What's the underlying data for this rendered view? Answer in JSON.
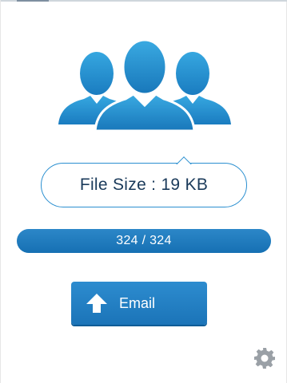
{
  "file_info": {
    "label": "File Size : 19 KB"
  },
  "progress": {
    "text": "324 / 324",
    "fraction": 1.0
  },
  "email_button": {
    "label": "Email",
    "icon": "up-arrow-icon"
  },
  "illustration": {
    "icon": "contacts-group-icon"
  },
  "settings": {
    "icon": "gear-icon"
  },
  "colors": {
    "accent": "#1b74b8",
    "illustration": "#2a93d0"
  }
}
